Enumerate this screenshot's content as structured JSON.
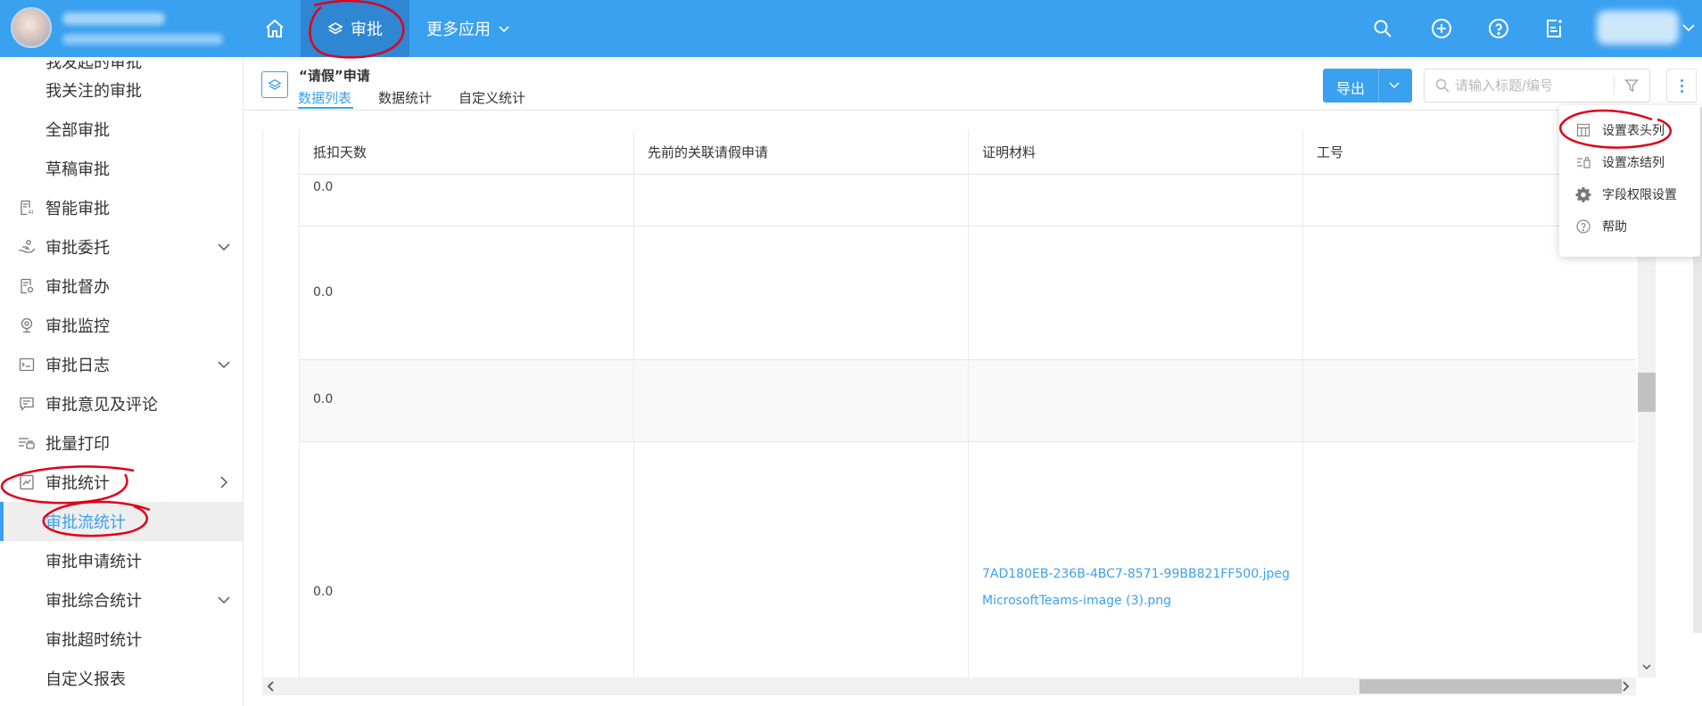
{
  "topbar": {
    "app_label": "审批",
    "more_apps_label": "更多应用"
  },
  "sidebar": {
    "items": [
      {
        "label": "我关注的审批"
      },
      {
        "label": "全部审批"
      },
      {
        "label": "草稿审批"
      },
      {
        "label": "智能审批"
      },
      {
        "label": "审批委托"
      },
      {
        "label": "审批督办"
      },
      {
        "label": "审批监控"
      },
      {
        "label": "审批日志"
      },
      {
        "label": "审批意见及评论"
      },
      {
        "label": "批量打印"
      },
      {
        "label": "审批统计"
      },
      {
        "label": "审批流统计"
      },
      {
        "label": "审批申请统计"
      },
      {
        "label": "审批综合统计"
      },
      {
        "label": "审批超时统计"
      },
      {
        "label": "自定义报表"
      }
    ]
  },
  "content": {
    "form_title": "“请假”申请",
    "tabs": [
      "数据列表",
      "数据统计",
      "自定义统计"
    ],
    "export_label": "导出",
    "search_placeholder": "请输入标题/编号"
  },
  "table": {
    "columns": [
      "抵扣天数",
      "先前的关联请假申请",
      "证明材料",
      "工号"
    ],
    "rows": [
      {
        "days": "0.0",
        "files": []
      },
      {
        "days": "0.0",
        "files": []
      },
      {
        "days": "0.0",
        "files": []
      },
      {
        "days": "0.0",
        "files": [
          "7AD180EB-236B-4BC7-8571-99BB821FF500.jpeg",
          "MicrosoftTeams-image (3).png"
        ]
      }
    ]
  },
  "menu": {
    "items": [
      "设置表头列",
      "设置冻结列",
      "字段权限设置",
      "帮助"
    ]
  },
  "colors": {
    "accent": "#3aa0f0",
    "topbar": "#3aa0f0",
    "annotation": "#e0001a"
  }
}
